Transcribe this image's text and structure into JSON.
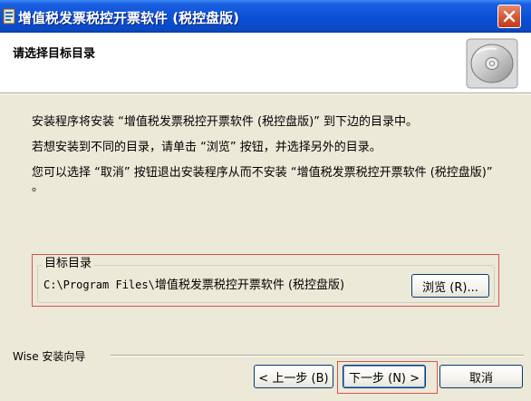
{
  "window": {
    "title": "增值税发票税控开票软件 (税控盘版)",
    "icons": {
      "app": "installer-icon",
      "close": "close-icon",
      "header": "cd-disc-icon"
    }
  },
  "header": {
    "title": "请选择目标目录"
  },
  "body": {
    "line1": "安装程序将安装 “增值税发票税控开票软件 (税控盘版)” 到下边的目录中。",
    "line2": "若想安装到不同的目录，请单击 “浏览” 按钮，并选择另外的目录。",
    "line3": "您可以选择 “取消” 按钮退出安装程序从而不安装 “增值税发票税控开票软件 (税控盘版)” 。"
  },
  "target_dir": {
    "label": "目标目录",
    "path_prefix": "C:\\Program Files\\",
    "path_suffix": "增值税发票税控开票软件 (税控盘版)",
    "browse_label": "浏览 (R)..."
  },
  "footer": {
    "wizard_label": "Wise 安装向导",
    "back_label": "< 上一步 (B)",
    "next_label": "下一步 (N) >",
    "cancel_label": "取消"
  },
  "colors": {
    "titlebar": "#0a4fd8",
    "highlight": "#d9534f",
    "dialog_bg": "#ece9d8"
  }
}
